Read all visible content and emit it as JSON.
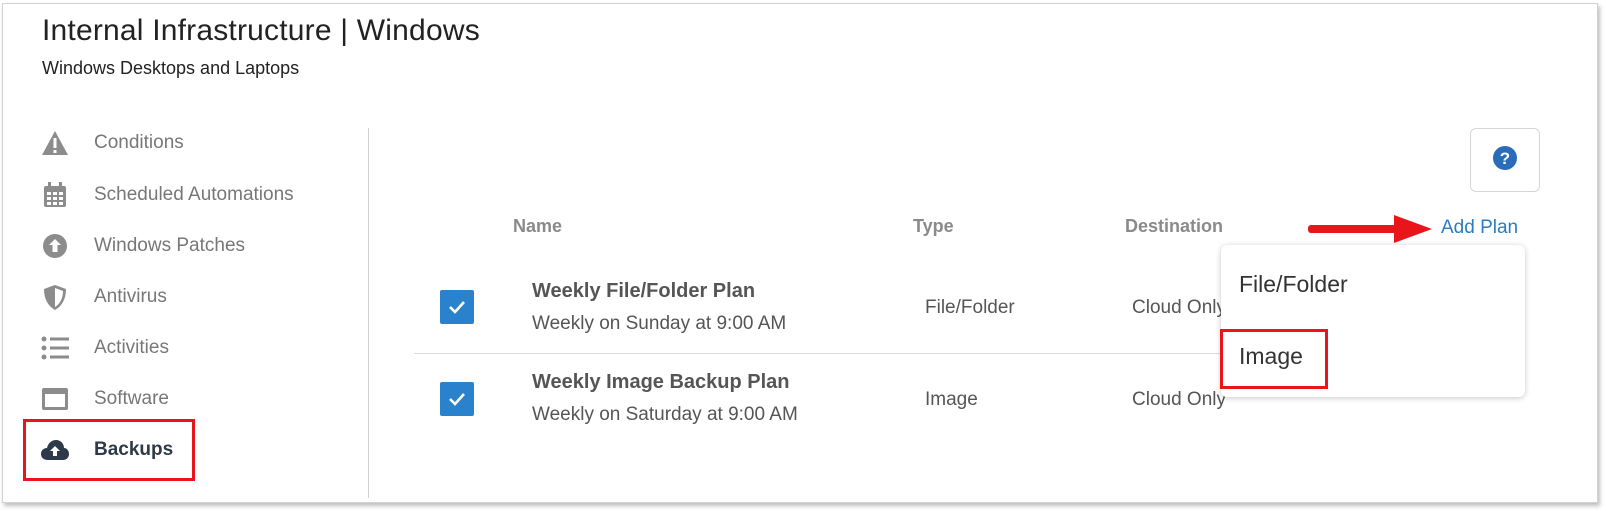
{
  "header": {
    "title": "Internal Infrastructure | Windows",
    "subtitle": "Windows Desktops and Laptops"
  },
  "sidebar": {
    "items": [
      {
        "label": "Conditions",
        "icon": "warning-icon"
      },
      {
        "label": "Scheduled Automations",
        "icon": "calendar-icon"
      },
      {
        "label": "Windows Patches",
        "icon": "upload-circle-icon"
      },
      {
        "label": "Antivirus",
        "icon": "shield-icon"
      },
      {
        "label": "Activities",
        "icon": "list-icon"
      },
      {
        "label": "Software",
        "icon": "window-icon"
      },
      {
        "label": "Backups",
        "icon": "cloud-upload-icon",
        "active": true
      }
    ]
  },
  "table": {
    "columns": [
      "Name",
      "Type",
      "Destination"
    ],
    "add_plan_label": "Add Plan",
    "rows": [
      {
        "checked": true,
        "name": "Weekly File/Folder Plan",
        "schedule": "Weekly on Sunday at 9:00 AM",
        "type": "File/Folder",
        "destination": "Cloud Only"
      },
      {
        "checked": true,
        "name": "Weekly Image Backup Plan",
        "schedule": "Weekly on Saturday at 9:00 AM",
        "type": "Image",
        "destination": "Cloud Only"
      }
    ]
  },
  "dropdown": {
    "options": [
      "File/Folder",
      "Image"
    ],
    "highlighted": "Image"
  },
  "colors": {
    "accent": "#2b82cc",
    "link": "#2a7dc4",
    "annotation": "#e8161b",
    "help_icon": "#2a6cb8"
  }
}
